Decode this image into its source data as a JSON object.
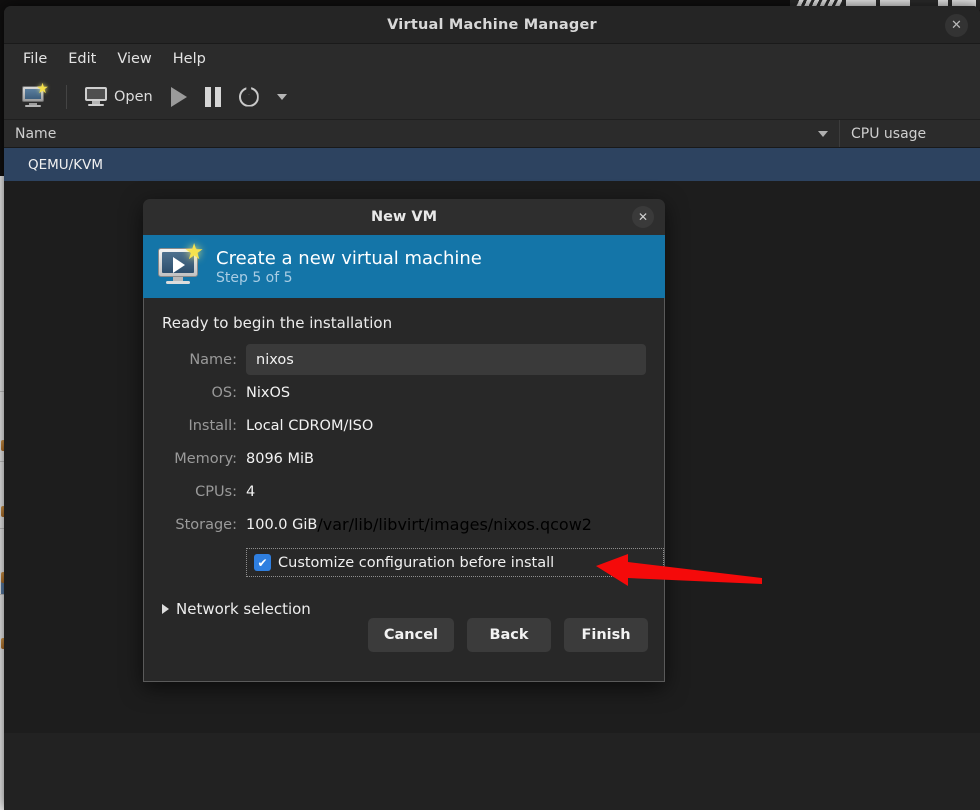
{
  "window": {
    "title": "Virtual Machine Manager",
    "close_label": "✕",
    "menu": [
      {
        "label": "File"
      },
      {
        "label": "Edit"
      },
      {
        "label": "View"
      },
      {
        "label": "Help"
      }
    ],
    "toolbar": [
      {
        "name": "new-vm",
        "label": "",
        "icon": "new-vm-icon"
      },
      {
        "name": "open",
        "label": "Open",
        "icon": "monitor-icon"
      },
      {
        "name": "run",
        "label": "",
        "icon": "play-icon"
      },
      {
        "name": "pause",
        "label": "",
        "icon": "pause-icon"
      },
      {
        "name": "shutdown",
        "label": "",
        "icon": "power-icon"
      },
      {
        "name": "shutdown-menu",
        "label": "",
        "icon": "chevron-down-icon"
      }
    ],
    "list": {
      "columns": [
        {
          "label": "Name"
        },
        {
          "label": "CPU usage"
        }
      ],
      "rows": [
        {
          "name": "QEMU/KVM",
          "cpu": ""
        }
      ]
    }
  },
  "dialog": {
    "title": "New VM",
    "close_label": "✕",
    "banner": {
      "heading": "Create a new virtual machine",
      "step": "Step 5 of 5",
      "color": "#1475a8"
    },
    "ready_text": "Ready to begin the installation",
    "fields": [
      {
        "label": "Name:",
        "value": "nixos",
        "type": "input"
      },
      {
        "label": "OS:",
        "value": "NixOS",
        "type": "text"
      },
      {
        "label": "Install:",
        "value": "Local CDROM/ISO",
        "type": "text"
      },
      {
        "label": "Memory:",
        "value": "8096 MiB",
        "type": "text"
      },
      {
        "label": "CPUs:",
        "value": "4",
        "type": "text"
      },
      {
        "label": "Storage:",
        "value": "100.0 GiB",
        "detail": "/var/lib/libvirt/images/nixos.qcow2",
        "type": "text"
      }
    ],
    "checkbox": {
      "label": "Customize configuration before install",
      "checked": true,
      "mark": "✔",
      "accent": "#2f7fe0"
    },
    "expander": {
      "label": "Network selection",
      "expanded": false
    },
    "buttons": [
      {
        "label": "Cancel"
      },
      {
        "label": "Back"
      },
      {
        "label": "Finish"
      }
    ]
  },
  "annotation": {
    "arrow_color": "#f50a0a",
    "points_to": "Customize configuration before install"
  }
}
